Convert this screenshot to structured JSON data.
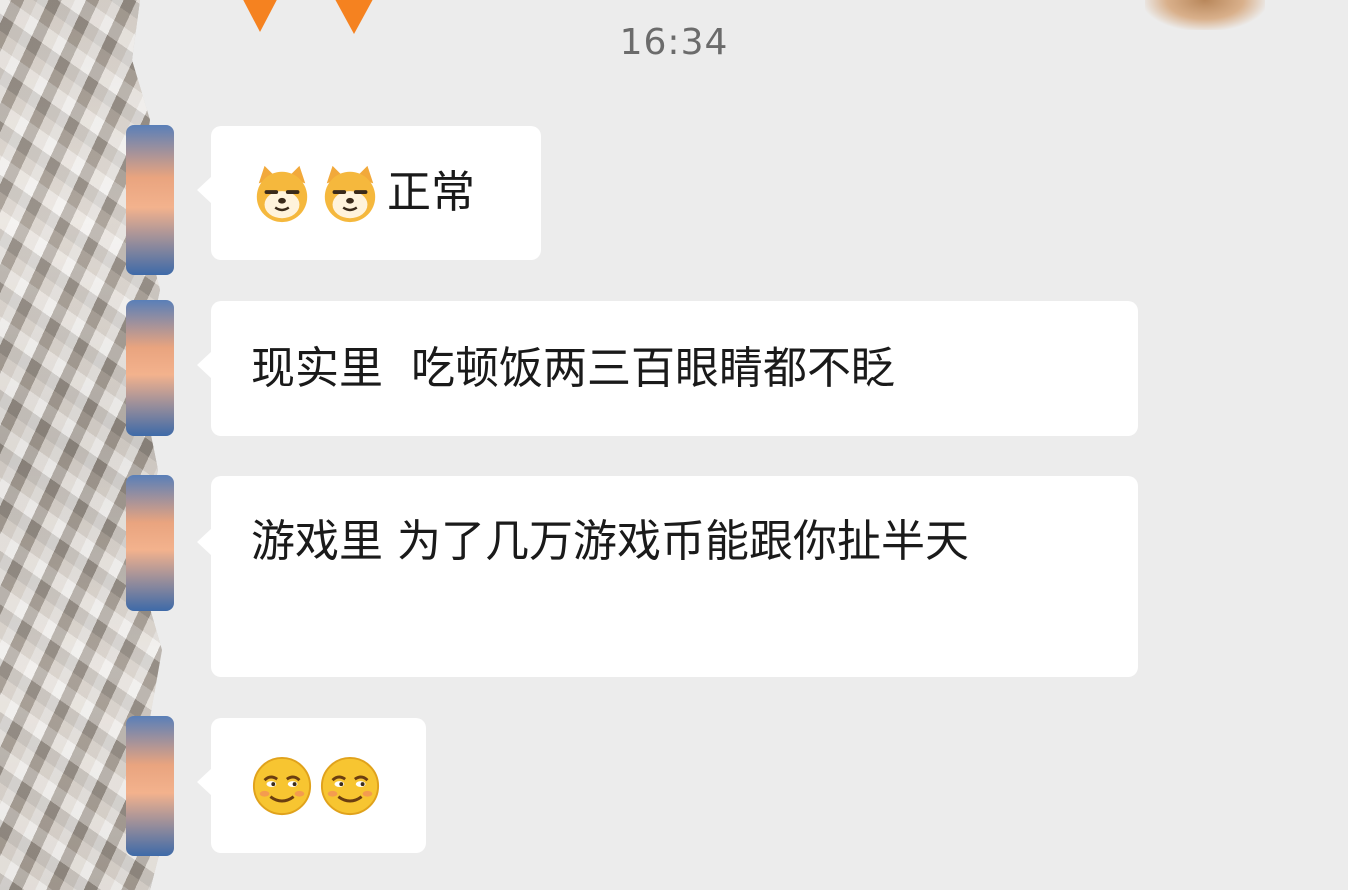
{
  "chat": {
    "timestamp": "16:34",
    "messages": [
      {
        "emojis": [
          "doge-emoji",
          "doge-emoji"
        ],
        "text": "正常"
      },
      {
        "emojis": [],
        "text": "现实里  吃顿饭两三百眼睛都不眨"
      },
      {
        "emojis": [],
        "text": "游戏里 为了几万游戏币能跟你扯半天"
      },
      {
        "emojis": [
          "smirk-emoji",
          "smirk-emoji"
        ],
        "text": ""
      }
    ]
  },
  "colors": {
    "background": "#ececec",
    "bubble": "#ffffff",
    "text": "#1a1a1a",
    "timestamp": "#6b6b6b",
    "decoration": "#f58220"
  }
}
